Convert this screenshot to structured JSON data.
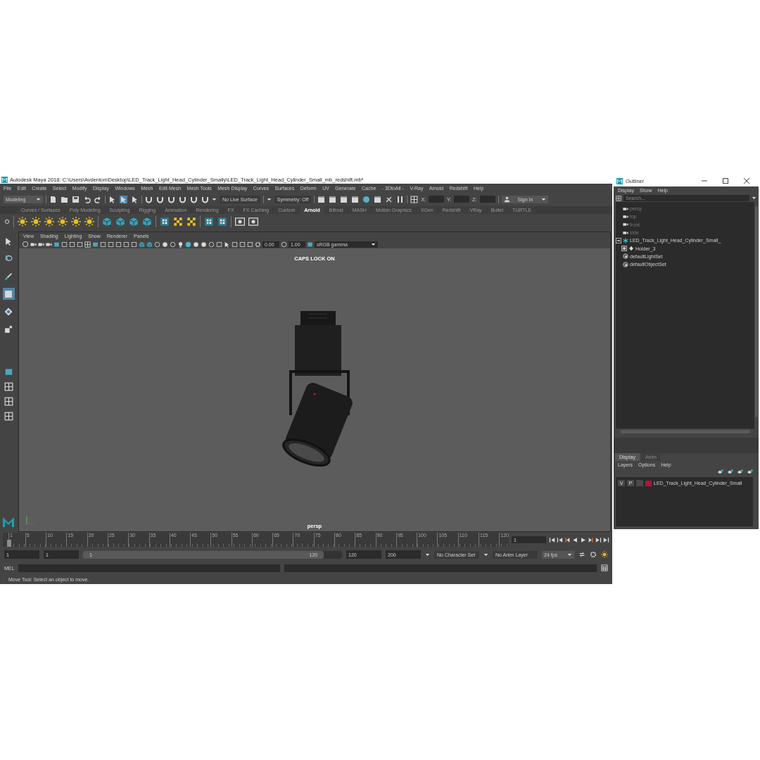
{
  "window": {
    "title": "Autodesk Maya 2018: C:\\Users\\Avdenton\\Desktop\\LED_Track_Light_Head_Cylinder_Smally\\LED_Track_Light_Head_Cylinder_Small_mb_redshift.mb*"
  },
  "menu": [
    "File",
    "Edit",
    "Create",
    "Select",
    "Modify",
    "Display",
    "Windows",
    "Mesh",
    "Edit Mesh",
    "Mesh Tools",
    "Mesh Display",
    "Curves",
    "Surfaces",
    "Deform",
    "UV",
    "Generate",
    "Cache",
    "- 3DtoAll -",
    "V-Ray",
    "Arnold",
    "Redshift",
    "Help"
  ],
  "status_line": {
    "menu_set": "Modeling",
    "live_surface": "No Live Surface",
    "symmetry": "Symmetry: Off",
    "coords": [
      "X:",
      "Y:",
      "Z:"
    ],
    "sign_in": "Sign In"
  },
  "shelf_tabs": [
    {
      "label": "Curves / Surfaces",
      "selected": false
    },
    {
      "label": "Poly Modeling",
      "selected": false
    },
    {
      "label": "Sculpting",
      "selected": false
    },
    {
      "label": "Rigging",
      "selected": false
    },
    {
      "label": "Animation",
      "selected": false
    },
    {
      "label": "Rendering",
      "selected": false
    },
    {
      "label": "FX",
      "selected": false
    },
    {
      "label": "FX Caching",
      "selected": false
    },
    {
      "label": "Custom",
      "selected": false
    },
    {
      "label": "Arnold",
      "selected": true
    },
    {
      "label": "Bifrost",
      "selected": false
    },
    {
      "label": "MASH",
      "selected": false
    },
    {
      "label": "Motion Graphics",
      "selected": false
    },
    {
      "label": "XGen",
      "selected": false
    },
    {
      "label": "Redshift",
      "selected": false
    },
    {
      "label": "VRay",
      "selected": false
    },
    {
      "label": "Bullet",
      "selected": false
    },
    {
      "label": "TURTLE",
      "selected": false
    }
  ],
  "toolbox": [
    {
      "kind": "select",
      "selected": false
    },
    {
      "kind": "lasso",
      "selected": false
    },
    {
      "kind": "paint",
      "selected": false
    },
    {
      "kind": "move",
      "selected": true
    },
    {
      "kind": "rotate",
      "selected": false
    },
    {
      "kind": "scale",
      "selected": false
    }
  ],
  "viewport": {
    "menu": [
      "View",
      "Shading",
      "Lighting",
      "Show",
      "Renderer",
      "Panels"
    ],
    "exposure": "0.00",
    "gamma": "1.00",
    "color_space": "sRGB gamma",
    "caps_lock": "CAPS LOCK ON",
    "camera": "persp"
  },
  "time_slider": {
    "ticks": [
      "1",
      "5",
      "10",
      "15",
      "20",
      "25",
      "30",
      "35",
      "40",
      "45",
      "50",
      "55",
      "60",
      "65",
      "70",
      "75",
      "80",
      "85",
      "90",
      "95",
      "100",
      "105",
      "110",
      "115",
      "120"
    ],
    "current_frame": "1",
    "level": 0
  },
  "range": {
    "start": "1",
    "playback_start": "1",
    "bar_start": "1",
    "bar_end": "120",
    "level": 0.93,
    "playback_end": "120",
    "end": "200",
    "character_set": "No Character Set",
    "anim_layer": "No Anim Layer",
    "fps": "24 fps"
  },
  "command_line": {
    "label": "MEL"
  },
  "help_line": "Move Tool: Select an object to move.",
  "outliner": {
    "title": "Outliner",
    "menu": [
      "Display",
      "Show",
      "Help"
    ],
    "search": {
      "placeholder": "Search..."
    },
    "items": [
      {
        "label": "persp",
        "kind": "camera",
        "dimmed": true
      },
      {
        "label": "top",
        "kind": "camera",
        "dimmed": true
      },
      {
        "label": "front",
        "kind": "camera",
        "dimmed": true
      },
      {
        "label": "side",
        "kind": "camera",
        "dimmed": true
      },
      {
        "label": "LED_Track_Light_Head_Cylinder_Small_",
        "kind": "group",
        "dimmed": false,
        "expanded": true,
        "children": [
          {
            "label": "Holder_3",
            "kind": "mesh",
            "dimmed": false,
            "expanded": false
          }
        ]
      },
      {
        "label": "defaultLightSet",
        "kind": "set",
        "dimmed": false
      },
      {
        "label": "defaultObjectSet",
        "kind": "set",
        "dimmed": false
      }
    ]
  },
  "layer_editor": {
    "tabs": [
      {
        "label": "Display",
        "selected": true
      },
      {
        "label": "Anim",
        "selected": false
      }
    ],
    "menu": [
      "Layers",
      "Options",
      "Help"
    ],
    "layers": [
      {
        "visible": "V",
        "playback": "P",
        "color": "#b8103a",
        "name": "LED_Track_Light_Head_Cylinder_Small"
      }
    ]
  }
}
